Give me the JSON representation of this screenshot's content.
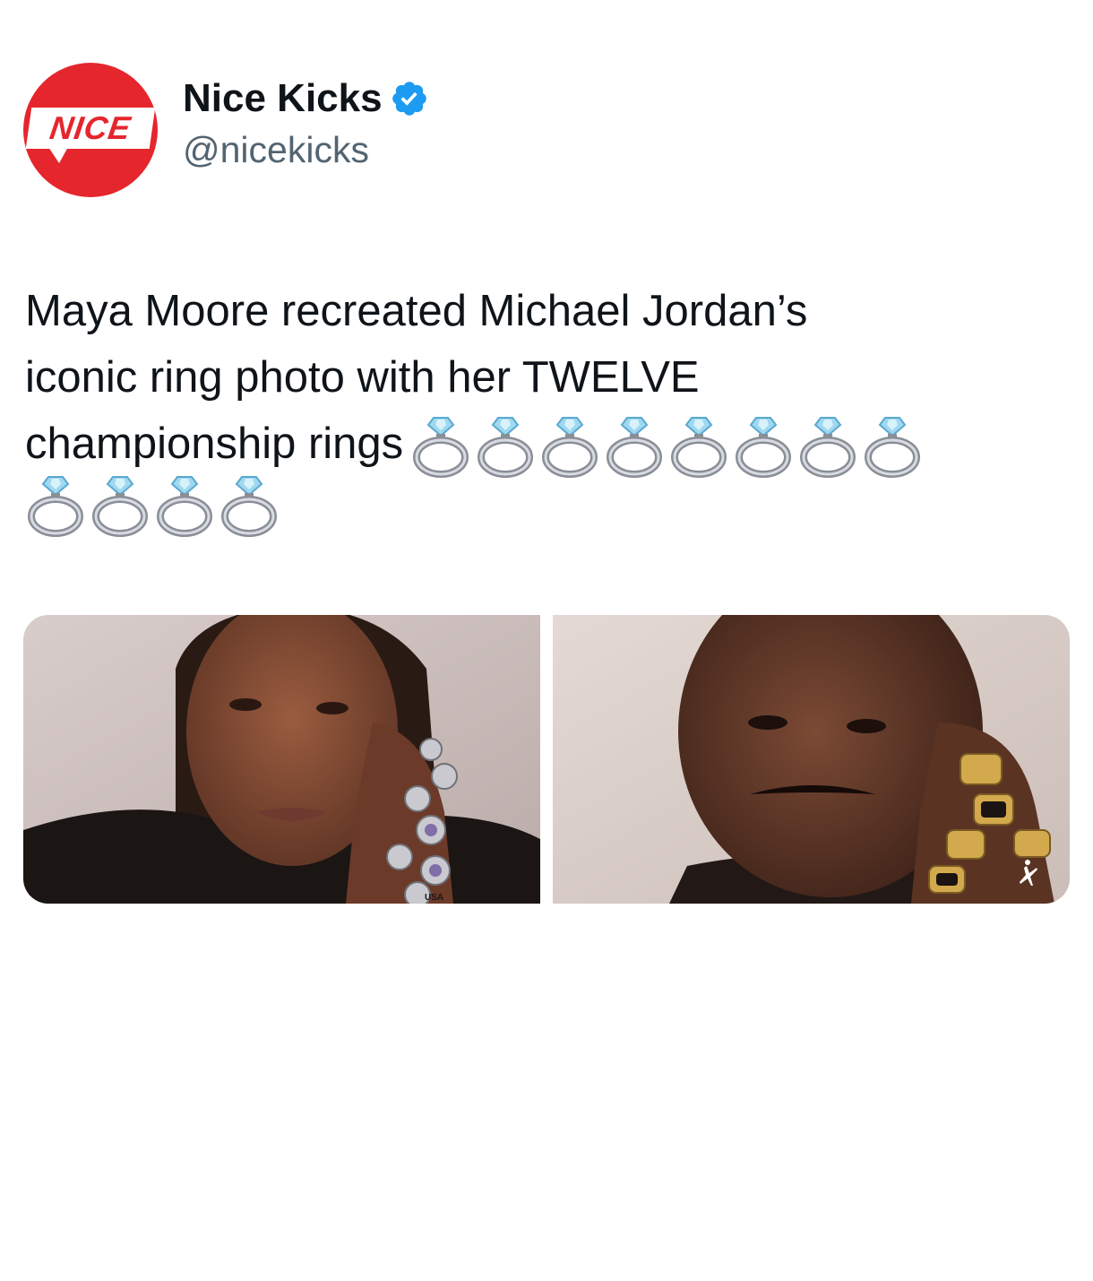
{
  "tweet": {
    "author": {
      "display_name": "Nice Kicks",
      "handle": "@nicekicks",
      "avatar_logo_text": "NICE",
      "verified": true,
      "verified_icon": "verified-badge-icon"
    },
    "text_lines": [
      "Maya Moore recreated Michael Jordan’s",
      "iconic ring photo with her TWELVE",
      "championship rings"
    ],
    "ring_emoji_count": 12,
    "ring_emoji_icon": "diamond-ring-icon",
    "media": [
      {
        "alt": "photo-maya-moore-rings",
        "usa_ring_text": "USA"
      },
      {
        "alt": "photo-michael-jordan-rings",
        "brand_icon": "jumpman-logo-icon"
      }
    ]
  },
  "colors": {
    "brand_red": "#e5262d",
    "verified_blue": "#1d9bf0",
    "handle_gray": "#536471",
    "text": "#0f1419"
  }
}
